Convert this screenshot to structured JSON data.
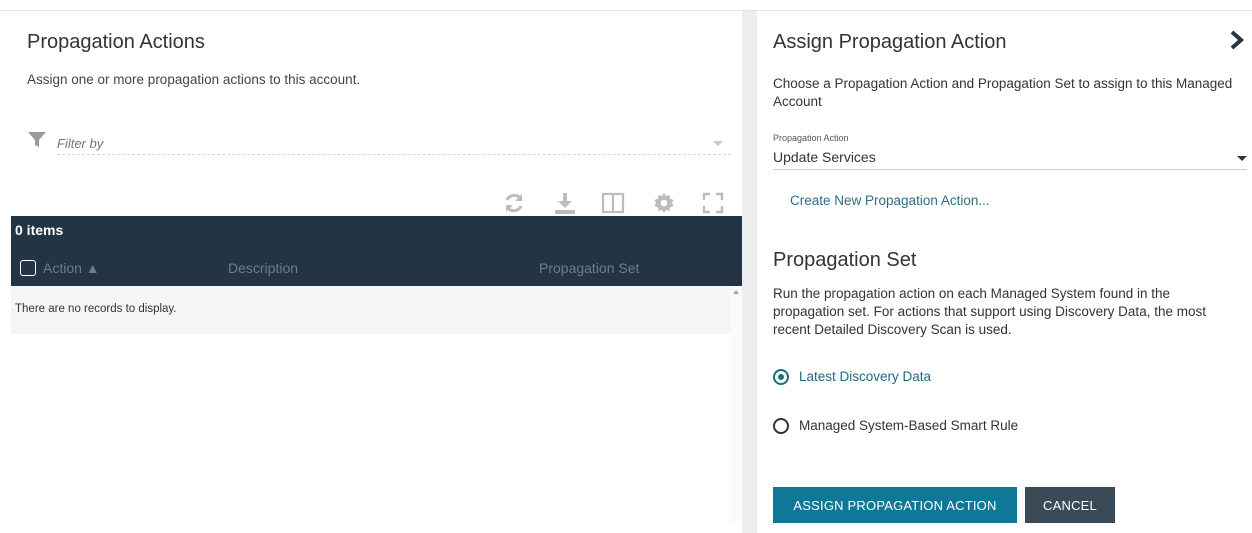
{
  "left_panel": {
    "title": "Propagation Actions",
    "subtitle": "Assign one or more propagation actions to this account.",
    "filter": {
      "placeholder": "Filter by",
      "icon": "filter-icon"
    },
    "toolbar": [
      {
        "name": "refresh-icon"
      },
      {
        "name": "download-icon"
      },
      {
        "name": "columns-icon"
      },
      {
        "name": "gear-icon"
      },
      {
        "name": "fullscreen-icon"
      }
    ],
    "grid": {
      "count_label": "0 items",
      "columns": [
        "Action ▲",
        "Description",
        "Propagation Set"
      ],
      "empty_message": "There are no records to display."
    }
  },
  "right_panel": {
    "title": "Assign Propagation Action",
    "description": "Choose a Propagation Action and Propagation Set to assign to this Managed Account",
    "field_label": "Propagation Action",
    "selected_action": "Update Services",
    "create_link": "Create New Propagation Action...",
    "propagation_set": {
      "title": "Propagation Set",
      "description": "Run the propagation action on each Managed System found in the propagation set. For actions that support using Discovery Data, the most recent Detailed Discovery Scan is used.",
      "options": [
        {
          "label": "Latest Discovery Data",
          "selected": true
        },
        {
          "label": "Managed System-Based Smart Rule",
          "selected": false
        }
      ]
    },
    "buttons": {
      "assign": "ASSIGN PROPAGATION ACTION",
      "cancel": "CANCEL"
    }
  },
  "colors": {
    "accent": "#0f7896",
    "grid_header": "#233444",
    "link": "#2a6f85",
    "cancel": "#3a4b57"
  }
}
